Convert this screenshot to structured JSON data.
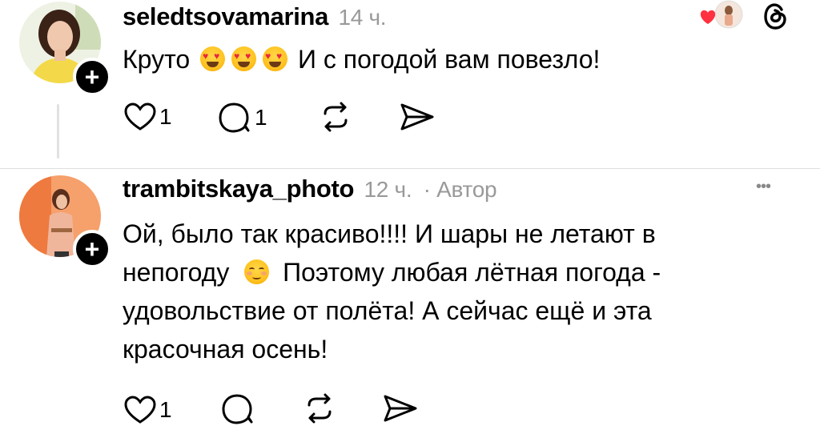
{
  "comments": [
    {
      "username": "seledtsovamarina",
      "time": "14 ч.",
      "text_before": "Круто",
      "text_after": " И с погодой вам повезло!",
      "likes": "1",
      "replies": "1",
      "emoji_icon": "heart-eyes-emoji"
    },
    {
      "username": "trambitskaya_photo",
      "time": "12 ч.",
      "author_tag": "· Автор",
      "lines": [
        "Ой, было так красиво!!!! И шары не летают в",
        "непогоду",
        "Поэтому любая лётная погода -",
        "удовольствие от полёта! А сейчас ещё и эта",
        "красочная осень!"
      ],
      "likes": "1",
      "emoji_icon": "smiling-blush-emoji"
    }
  ],
  "more_glyph": "•••",
  "colors": {
    "meta": "#999999",
    "heart": "#ff3040",
    "thread_line": "#e1e1e1"
  }
}
